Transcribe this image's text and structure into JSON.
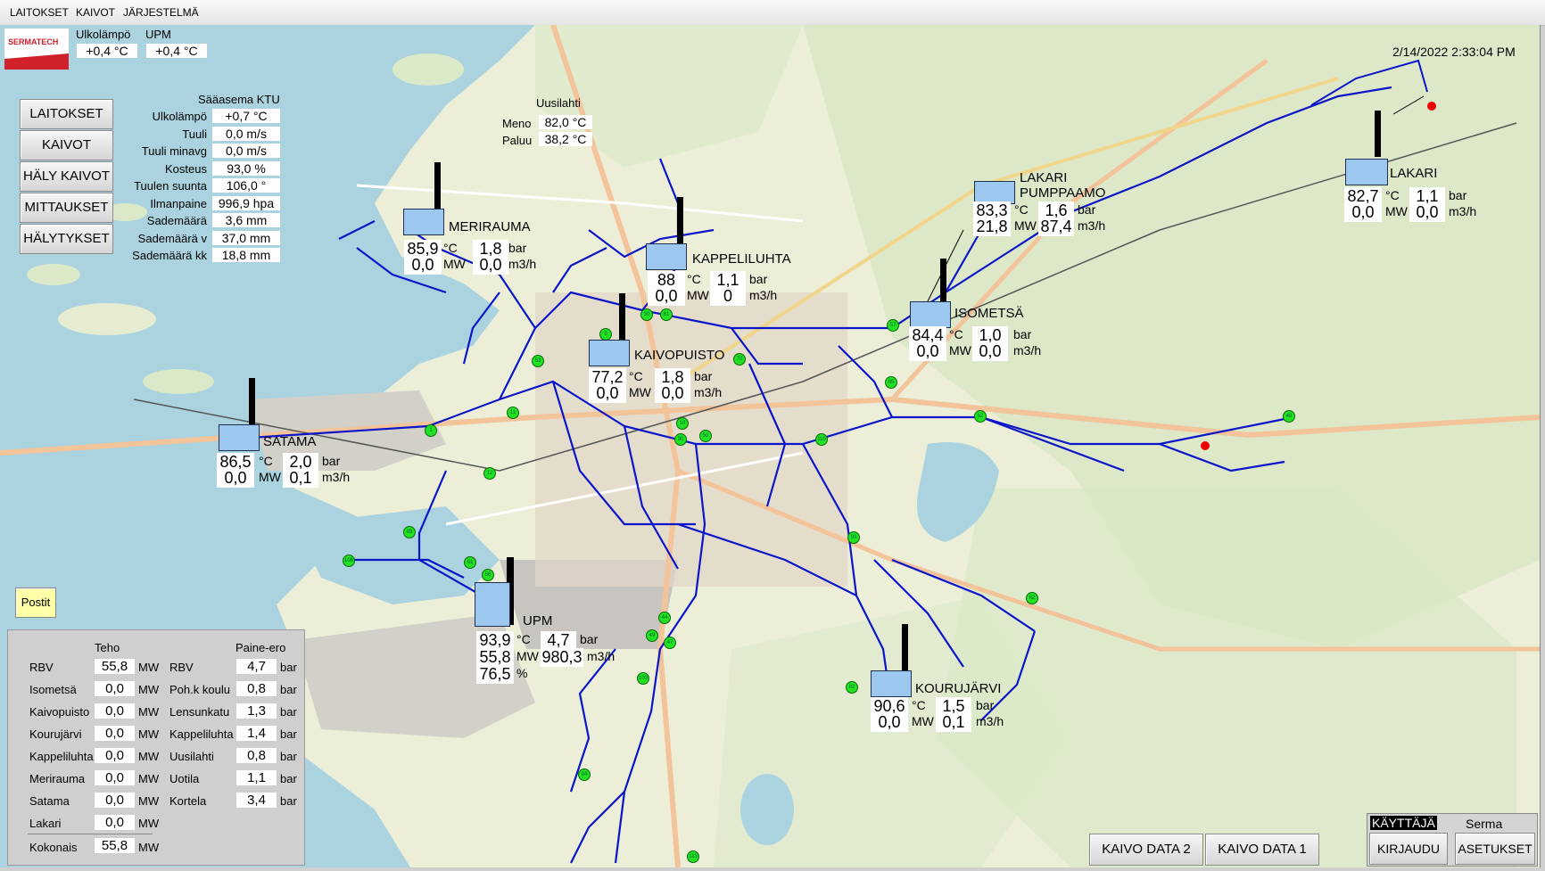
{
  "menu": [
    "LAITOKSET",
    "KAIVOT",
    "JÄRJESTELMÄ"
  ],
  "logo": "SERMATECH",
  "header": {
    "ulkolampo_label": "Ulkolämpö",
    "ulkolampo_value": "+0,4 °C",
    "upm_label": "UPM",
    "upm_value": "+0,4 °C"
  },
  "datetime": "2/14/2022 2:33:04 PM",
  "nav_buttons": [
    "LAITOKSET",
    "KAIVOT",
    "HÄLY KAIVOT",
    "MITTAUKSET",
    "HÄLYTYKSET"
  ],
  "postit": "Postit",
  "weather": {
    "title": "Sääasema KTU",
    "rows": [
      {
        "label": "Ulkolämpö",
        "value": "+0,7 °C"
      },
      {
        "label": "Tuuli",
        "value": "0,0 m/s"
      },
      {
        "label": "Tuuli minavg",
        "value": "0,0 m/s"
      },
      {
        "label": "Kosteus",
        "value": "93,0 %"
      },
      {
        "label": "Tuulen suunta",
        "value": "106,0 °"
      },
      {
        "label": "Ilmanpaine",
        "value": "996,9 hpa"
      },
      {
        "label": "Sademäärä",
        "value": "3,6 mm"
      },
      {
        "label": "Sademäärä v",
        "value": "37,0 mm"
      },
      {
        "label": "Sademäärä kk",
        "value": "18,8 mm"
      }
    ]
  },
  "uusilahti": {
    "title": "Uusilahti",
    "meno_label": "Meno",
    "meno": "82,0 °C",
    "paluu_label": "Paluu",
    "paluu": "38,2 °C"
  },
  "units": {
    "c": "°C",
    "bar": "bar",
    "mw": "MW",
    "m3h": "m3/h",
    "pct": "%"
  },
  "plants": {
    "merirauma": {
      "name": "MERIRAUMA",
      "temp": "85,9",
      "pressure": "1,8",
      "power": "0,0",
      "flow": "0,0"
    },
    "kappeliluhta": {
      "name": "KAPPELILUHTA",
      "temp": "88",
      "pressure": "1,1",
      "power": "0,0",
      "flow": "0"
    },
    "kaivopuisto": {
      "name": "KAIVOPUISTO",
      "temp": "77,2",
      "pressure": "1,8",
      "power": "0,0",
      "flow": "0,0"
    },
    "lakari_pumppaamo": {
      "name1": "LAKARI",
      "name2": "PUMPPAAMO",
      "temp": "83,3",
      "pressure": "1,6",
      "power": "21,8",
      "flow": "87,4"
    },
    "isometsa": {
      "name": "ISOMETSÄ",
      "temp": "84,4",
      "pressure": "1,0",
      "power": "0,0",
      "flow": "0,0"
    },
    "lakari": {
      "name": "LAKARI",
      "temp": "82,7",
      "pressure": "1,1",
      "power": "0,0",
      "flow": "0,0"
    },
    "satama": {
      "name": "SATAMA",
      "temp": "86,5",
      "pressure": "2,0",
      "power": "0,0",
      "flow": "0,1"
    },
    "upm": {
      "name": "UPM",
      "temp": "93,9",
      "pressure": "4,7",
      "power": "55,8",
      "flow": "980,3",
      "pct": "76,5"
    },
    "kourujarvi": {
      "name": "KOURUJÄRVI",
      "temp": "90,6",
      "pressure": "1,5",
      "power": "0,0",
      "flow": "0,1"
    }
  },
  "status_panel": {
    "teho_header": "Teho",
    "paine_header": "Paine-ero",
    "teho": [
      {
        "label": "RBV",
        "value": "55,8"
      },
      {
        "label": "Isometsä",
        "value": "0,0"
      },
      {
        "label": "Kaivopuisto",
        "value": "0,0"
      },
      {
        "label": "Kourujärvi",
        "value": "0,0"
      },
      {
        "label": "Kappeliluhta",
        "value": "0,0"
      },
      {
        "label": "Merirauma",
        "value": "0,0"
      },
      {
        "label": "Satama",
        "value": "0,0"
      },
      {
        "label": "Lakari",
        "value": "0,0"
      }
    ],
    "paine": [
      {
        "label": "RBV",
        "value": "4,7"
      },
      {
        "label": "Poh.k koulu",
        "value": "0,8"
      },
      {
        "label": "Lensunkatu",
        "value": "1,3"
      },
      {
        "label": "Kappeliluhta",
        "value": "1,4"
      },
      {
        "label": "Uusilahti",
        "value": "0,8"
      },
      {
        "label": "Uotila",
        "value": "1,1"
      },
      {
        "label": "Kortela",
        "value": "3,4"
      }
    ],
    "total_label": "Kokonais",
    "total_value": "55,8"
  },
  "bottom_buttons": {
    "kaivo_data_2": "KAIVO DATA 2",
    "kaivo_data_1": "KAIVO DATA 1",
    "kirjaudu": "KIRJAUDU",
    "asetukset": "ASETUKSET"
  },
  "user": {
    "label": "KÄYTTÄJÄ",
    "name": "Serma"
  },
  "nodes": [
    "53",
    "30",
    "81",
    "9",
    "11",
    "1",
    "70",
    "10",
    "50",
    "90",
    "110",
    "57",
    "85",
    "62",
    "48",
    "12",
    "89",
    "106",
    "81",
    "56",
    "93",
    "62",
    "44",
    "49",
    "47",
    "103",
    "82",
    "94",
    "113",
    "112",
    "110"
  ],
  "colors": {
    "water": "#aad3df",
    "pipe": "#0b16c8",
    "node": "#22e022",
    "tank": "#9cc8f0",
    "land": "#e9ead3"
  }
}
